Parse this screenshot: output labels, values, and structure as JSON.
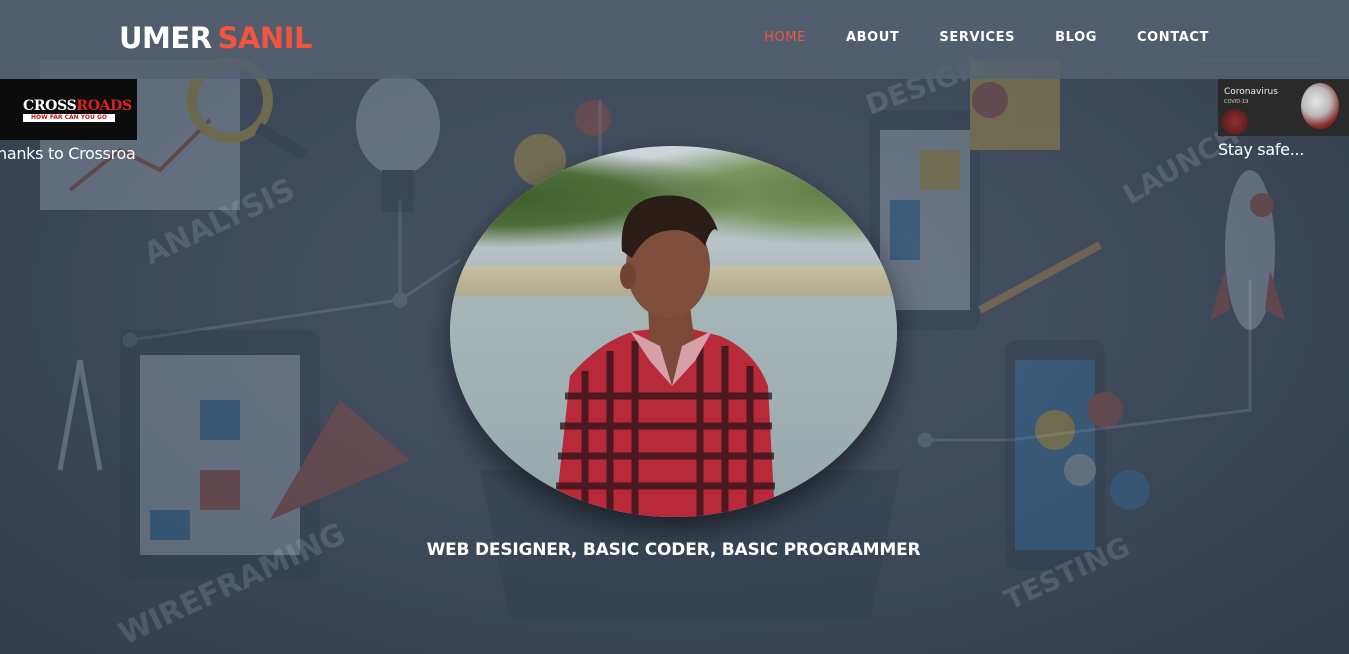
{
  "header": {
    "logo_first": "UMER",
    "logo_second": "SANIL",
    "nav": [
      {
        "label": "HOME",
        "active": true
      },
      {
        "label": "ABOUT",
        "active": false
      },
      {
        "label": "SERVICES",
        "active": false
      },
      {
        "label": "BLOG",
        "active": false
      },
      {
        "label": "CONTACT",
        "active": false
      }
    ]
  },
  "left_card": {
    "logo_text_a": "CROSS",
    "logo_text_b": "ROADS",
    "logo_tagline": "HOW FAR CAN YOU GO",
    "caption": "hanks to Crossroa"
  },
  "right_card": {
    "title": "Coronavirus",
    "subtitle": "COVID-19",
    "caption": "Stay safe..."
  },
  "hero": {
    "tagline": "WEB DESIGNER, BASIC CODER, BASIC PROGRAMMER"
  },
  "background_words": [
    "ANALYSIS",
    "DESIGN",
    "LAUNCH",
    "WIREFRAMING",
    "TESTING"
  ],
  "colors": {
    "accent": "#f2543d",
    "header_bg": "#566171",
    "page_bg": "#3b4656"
  }
}
